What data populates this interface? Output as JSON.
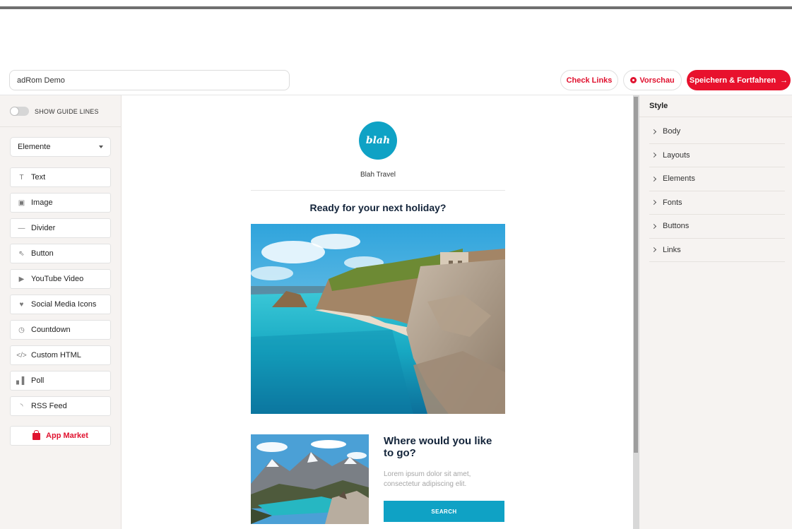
{
  "header": {
    "title_value": "adRom Demo",
    "check_links_label": "Check Links",
    "preview_label": "Vorschau",
    "save_label": "Speichern & Fortfahren",
    "save_arrow": "→"
  },
  "left_sidebar": {
    "guide_lines_label": "SHOW GUIDE LINES",
    "dropdown_selected": "Elemente",
    "elements": [
      {
        "label": "Text",
        "icon": "text-icon",
        "glyph": "T"
      },
      {
        "label": "Image",
        "icon": "image-icon",
        "glyph": "▣"
      },
      {
        "label": "Divider",
        "icon": "divider-icon",
        "glyph": "—"
      },
      {
        "label": "Button",
        "icon": "button-cursor-icon",
        "glyph": "⇖"
      },
      {
        "label": "YouTube Video",
        "icon": "video-icon",
        "glyph": "▶"
      },
      {
        "label": "Social Media Icons",
        "icon": "heart-icon",
        "glyph": "♥"
      },
      {
        "label": "Countdown",
        "icon": "clock-icon",
        "glyph": "◷"
      },
      {
        "label": "Custom HTML",
        "icon": "code-icon",
        "glyph": "</>"
      },
      {
        "label": "Poll",
        "icon": "bar-chart-icon",
        "glyph": "▖▌"
      },
      {
        "label": "RSS Feed",
        "icon": "rss-icon",
        "glyph": "◝"
      }
    ],
    "app_market_label": "App Market"
  },
  "canvas": {
    "logo_text": "blah",
    "brand_name": "Blah Travel",
    "headline": "Ready for your next holiday?",
    "sub_headline": "Where would you like to go?",
    "body_text": "Lorem ipsum dolor sit amet, consectetur adipiscing elit.",
    "search_label": "SEARCH"
  },
  "right_sidebar": {
    "title": "Style",
    "sections": [
      "Body",
      "Layouts",
      "Elements",
      "Fonts",
      "Buttons",
      "Links"
    ]
  },
  "colors": {
    "accent": "#e8112d",
    "brand": "#0fa2c5",
    "heading": "#13243a"
  }
}
